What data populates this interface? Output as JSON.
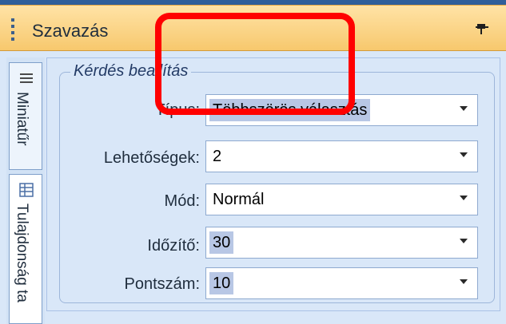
{
  "panel": {
    "title": "Szavazás"
  },
  "tabs": [
    {
      "label": "Miniatűr",
      "icon": "list-icon"
    },
    {
      "label": "Tulajdonság ta",
      "icon": "grid-icon"
    }
  ],
  "group": {
    "title": "Kérdés beallítás"
  },
  "fields": [
    {
      "label": "Típus:",
      "value": "Többszörös választás"
    },
    {
      "label": "Lehetőségek:",
      "value": "2"
    },
    {
      "label": "Mód:",
      "value": "Normál"
    },
    {
      "label": "Időzítő:",
      "value": "30"
    },
    {
      "label": "Pontszám:",
      "value": "10"
    }
  ],
  "colors": {
    "header": "#f7c86d",
    "panel": "#d9e7f8",
    "annotation": "#ff0000"
  }
}
